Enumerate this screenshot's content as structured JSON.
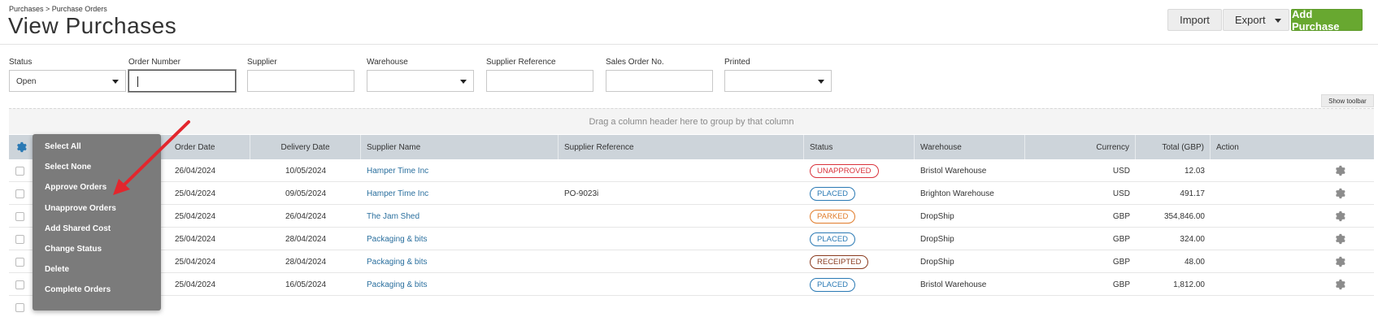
{
  "header": {
    "breadcrumb": "Purchases > Purchase Orders",
    "title": "View Purchases",
    "import_label": "Import",
    "export_label": "Export",
    "add_label": "Add Purchase"
  },
  "filters": {
    "status_label": "Status",
    "status_value": "Open",
    "order_number_label": "Order Number",
    "supplier_label": "Supplier",
    "warehouse_label": "Warehouse",
    "supplier_ref_label": "Supplier Reference",
    "sales_order_label": "Sales Order No.",
    "printed_label": "Printed"
  },
  "toolbar": {
    "show_toolbar": "Show toolbar"
  },
  "group_hint": "Drag a column header here to group by that column",
  "columns": {
    "order_date": "Order Date",
    "delivery_date": "Delivery Date",
    "supplier_name": "Supplier Name",
    "supplier_reference": "Supplier Reference",
    "status": "Status",
    "warehouse": "Warehouse",
    "currency": "Currency",
    "total": "Total (GBP)",
    "action": "Action"
  },
  "rows": [
    {
      "order_date": "26/04/2024",
      "delivery_date": "10/05/2024",
      "supplier": "Hamper Time Inc",
      "ref": "",
      "status": "UNAPPROVED",
      "warehouse": "Bristol Warehouse",
      "currency": "USD",
      "total": "12.03"
    },
    {
      "order_date": "25/04/2024",
      "delivery_date": "09/05/2024",
      "supplier": "Hamper Time Inc",
      "ref": "PO-9023i",
      "status": "PLACED",
      "warehouse": "Brighton Warehouse",
      "currency": "USD",
      "total": "491.17"
    },
    {
      "order_date": "25/04/2024",
      "delivery_date": "26/04/2024",
      "supplier": "The Jam Shed",
      "ref": "",
      "status": "PARKED",
      "warehouse": "DropShip",
      "currency": "GBP",
      "total": "354,846.00"
    },
    {
      "order_date": "25/04/2024",
      "delivery_date": "28/04/2024",
      "supplier": "Packaging & bits",
      "ref": "",
      "status": "PLACED",
      "warehouse": "DropShip",
      "currency": "GBP",
      "total": "324.00"
    },
    {
      "order_date": "25/04/2024",
      "delivery_date": "28/04/2024",
      "supplier": "Packaging & bits",
      "ref": "",
      "status": "RECEIPTED",
      "warehouse": "DropShip",
      "currency": "GBP",
      "total": "48.00"
    },
    {
      "order_date": "25/04/2024",
      "delivery_date": "16/05/2024",
      "supplier": "Packaging & bits",
      "ref": "",
      "status": "PLACED",
      "warehouse": "Bristol Warehouse",
      "currency": "GBP",
      "total": "1,812.00"
    }
  ],
  "menu": {
    "items": [
      "Select All",
      "Select None",
      "Approve Orders",
      "Unapprove Orders",
      "Add Shared Cost",
      "Change Status",
      "Delete",
      "Complete Orders"
    ]
  },
  "status_colors": {
    "UNAPPROVED": "#d9323b",
    "PLACED": "#2a79b4",
    "PARKED": "#e07b29",
    "RECEIPTED": "#8a3b1f"
  },
  "colors": {
    "accent": "#68a830",
    "link": "#2a6f9e",
    "annotation_arrow": "#e3262d"
  },
  "icons": {
    "header_settings": "gear-icon",
    "row_action": "gear-icon",
    "annotation": "red-arrow-icon"
  }
}
